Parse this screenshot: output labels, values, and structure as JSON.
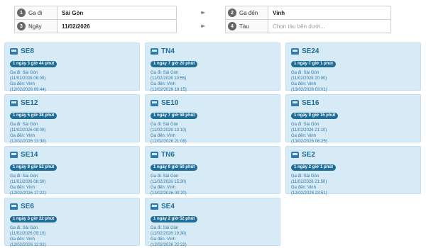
{
  "form": {
    "from": {
      "num": "1",
      "label": "Ga đi",
      "value": "Sài Gòn"
    },
    "to": {
      "num": "2",
      "label": "Ga đến",
      "value": "Vinh"
    },
    "date": {
      "num": "3",
      "label": "Ngày",
      "value": "11/02/2026"
    },
    "train": {
      "num": "4",
      "label": "Tàu",
      "placeholder": "Chọn tàu bên dưới..."
    },
    "arrow_glyph": "▸▸"
  },
  "trains": [
    {
      "name": "SE8",
      "duration": "1 ngày 3 giờ 44 phút",
      "dep_label": "Ga đi: Sài Gòn",
      "dep_time": "(11/02/2026 06:00)",
      "arr_label": "Ga đến: Vinh",
      "arr_time": "(12/02/2026 09:44)"
    },
    {
      "name": "TN4",
      "duration": "1 ngày 7 giờ 20 phút",
      "dep_label": "Ga đi: Sài Gòn",
      "dep_time": "(11/02/2026 10:55)",
      "arr_label": "Ga đến: Vinh",
      "arr_time": "(12/02/2026 18:15)"
    },
    {
      "name": "SE24",
      "duration": "1 ngày 7 giờ 1 phút",
      "dep_label": "Ga đi: Sài Gòn",
      "dep_time": "(11/02/2026 20:00)",
      "arr_label": "Ga đến: Vinh",
      "arr_time": "(13/02/2026 03:01)"
    },
    {
      "name": "SE12",
      "duration": "1 ngày 5 giờ 38 phút",
      "dep_label": "Ga đi: Sài Gòn",
      "dep_time": "(11/02/2026 08:00)",
      "arr_label": "Ga đến: Vinh",
      "arr_time": "(12/02/2026 13:38)"
    },
    {
      "name": "SE10",
      "duration": "1 ngày 7 giờ 58 phút",
      "dep_label": "Ga đi: Sài Gòn",
      "dep_time": "(11/02/2026 13:10)",
      "arr_label": "Ga đến: Vinh",
      "arr_time": "(12/02/2026 21:08)"
    },
    {
      "name": "SE16",
      "duration": "1 ngày 9 giờ 15 phút",
      "dep_label": "Ga đi: Sài Gòn",
      "dep_time": "(11/02/2026 21:10)",
      "arr_label": "Ga đến: Vinh",
      "arr_time": "(13/02/2026 06:25)"
    },
    {
      "name": "SE14",
      "duration": "1 ngày 8 giờ 52 phút",
      "dep_label": "Ga đi: Sài Gòn",
      "dep_time": "(11/02/2026 08:30)",
      "arr_label": "Ga đến: Vinh",
      "arr_time": "(12/02/2026 17:22)"
    },
    {
      "name": "TN6",
      "duration": "1 ngày 8 giờ 50 phút",
      "dep_label": "Ga đi: Sài Gòn",
      "dep_time": "(11/02/2026 15:30)",
      "arr_label": "Ga đến: Vinh",
      "arr_time": "(13/02/2026 00:20)"
    },
    {
      "name": "SE2",
      "duration": "1 ngày 2 giờ 1 phút",
      "dep_label": "Ga đi: Sài Gòn",
      "dep_time": "(11/02/2026 21:50)",
      "arr_label": "Ga đến: Vinh",
      "arr_time": "(12/02/2026 23:51)"
    },
    {
      "name": "SE6",
      "duration": "1 ngày 3 giờ 22 phút",
      "dep_label": "Ga đi: Sài Gòn",
      "dep_time": "(11/02/2026 09:10)",
      "arr_label": "Ga đến: Vinh",
      "arr_time": "(12/02/2026 12:32)"
    },
    {
      "name": "SE4",
      "duration": "1 ngày 2 giờ 52 phút",
      "dep_label": "Ga đi: Sài Gòn",
      "dep_time": "(11/02/2026 19:30)",
      "arr_label": "Ga đến: Vinh",
      "arr_time": "(12/02/2026 22:22)"
    }
  ]
}
